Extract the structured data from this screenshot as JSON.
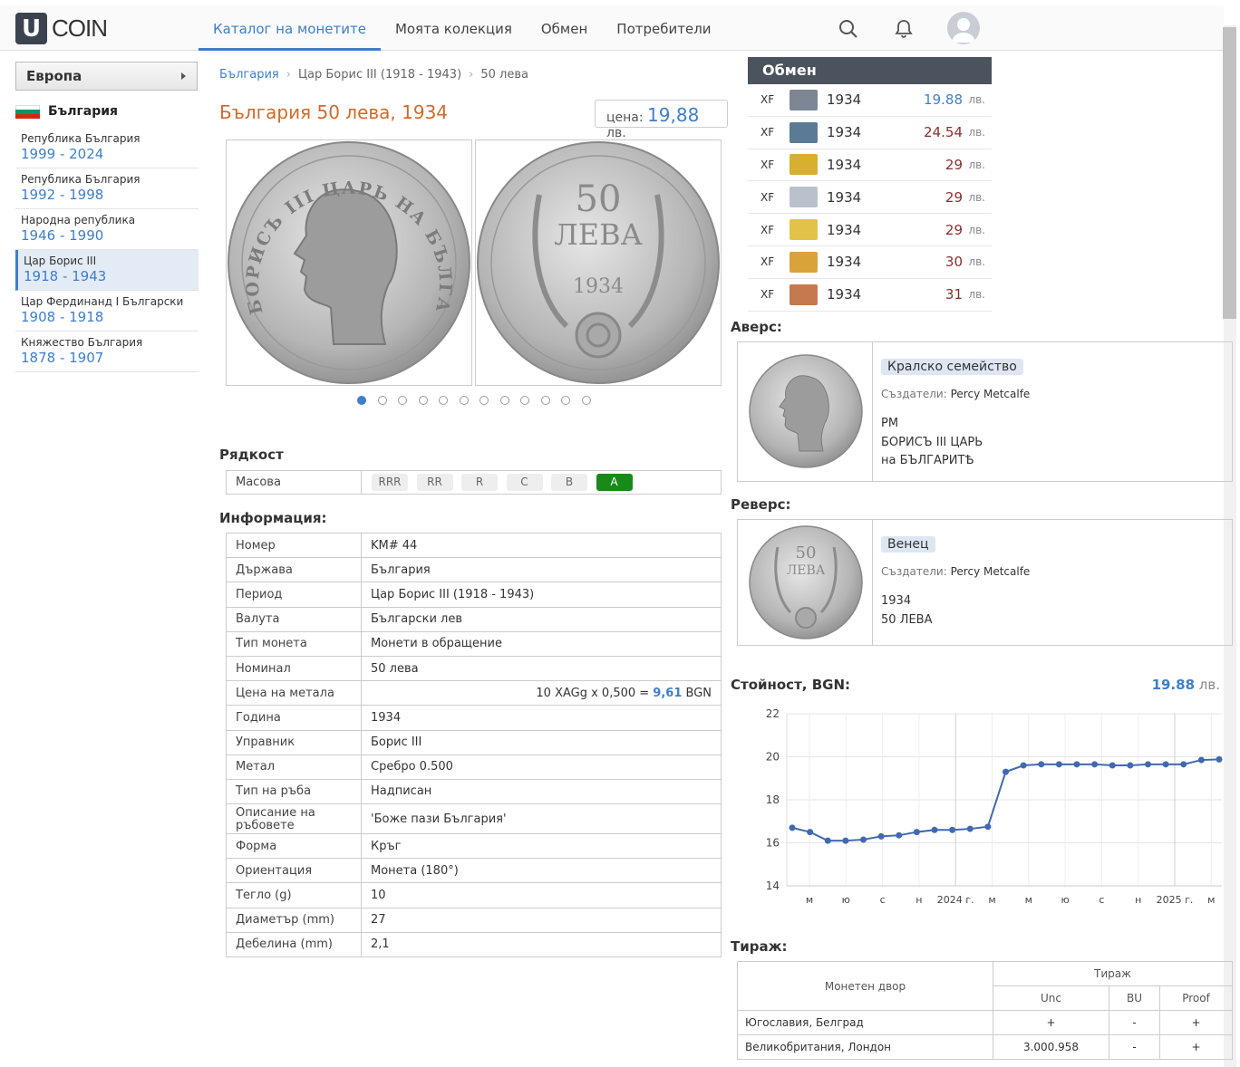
{
  "header": {
    "logo_letter": "U",
    "logo_text": "COIN",
    "nav": [
      "Каталог на монетите",
      "Моята колекция",
      "Обмен",
      "Потребители"
    ]
  },
  "sidebar": {
    "region": "Европа",
    "country": "България",
    "periods": [
      {
        "name": "Република България",
        "years": "1999 - 2024"
      },
      {
        "name": "Република България",
        "years": "1992 - 1998"
      },
      {
        "name": "Народна република",
        "years": "1946 - 1990"
      },
      {
        "name": "Цар Борис III",
        "years": "1918 - 1943"
      },
      {
        "name": "Цар Фердинанд I Български",
        "years": "1908 - 1918"
      },
      {
        "name": "Княжество България",
        "years": "1878 - 1907"
      }
    ]
  },
  "breadcrumb": [
    "България",
    "Цар Борис III (1918 - 1943)",
    "50 лева"
  ],
  "coin": {
    "title": "България 50 лева, 1934",
    "price_label": "цена:",
    "price_value": "19,88",
    "price_unit": "лв.",
    "obverse_portrait_text": "БОРИСЪ III ЦАРЬ НА БЪЛГАРИТѢ",
    "reverse_big": "50",
    "reverse_word": "ЛЕВА",
    "reverse_year": "1934"
  },
  "rarity": {
    "heading": "Рядкост",
    "label": "Масова",
    "levels": [
      "RRR",
      "RR",
      "R",
      "C",
      "B",
      "A"
    ],
    "active": "A"
  },
  "info": {
    "heading": "Информация:",
    "rows": [
      {
        "k": "Номер",
        "v": "KM# 44"
      },
      {
        "k": "Държава",
        "v": "България"
      },
      {
        "k": "Период",
        "v": "Цар Борис III (1918 - 1943)"
      },
      {
        "k": "Валута",
        "v": "Български лев"
      },
      {
        "k": "Тип монета",
        "v": "Монети в обращение"
      },
      {
        "k": "Номинал",
        "v": "50 лева"
      },
      {
        "k": "Цена на метала",
        "v": "10 XAGg x 0,500 = ",
        "v_bold": "9,61",
        "v_tail": " BGN"
      },
      {
        "k": "Година",
        "v": "1934"
      },
      {
        "k": "Управник",
        "v": "Борис III"
      },
      {
        "k": "Метал",
        "v": "Сребро 0.500"
      },
      {
        "k": "Тип на ръба",
        "v": "Надписан"
      },
      {
        "k": "Описание на ръбовете",
        "v": "'Боже пази България'"
      },
      {
        "k": "Форма",
        "v": "Кръг"
      },
      {
        "k": "Ориентация",
        "v": "Монета (180°)"
      },
      {
        "k": "Тегло (g)",
        "v": "10"
      },
      {
        "k": "Диаметър (mm)",
        "v": "27"
      },
      {
        "k": "Дебелина (mm)",
        "v": "2,1"
      }
    ]
  },
  "exchange": {
    "heading": "Обмен",
    "rows": [
      {
        "grade": "XF",
        "year": "1934",
        "price": "19.88",
        "unit": "лв.",
        "color": "#3f7ec9",
        "thumb": "#7d8694"
      },
      {
        "grade": "XF",
        "year": "1934",
        "price": "24.54",
        "unit": "лв.",
        "color": "#8b2d2d",
        "thumb": "#5b7a94"
      },
      {
        "grade": "XF",
        "year": "1934",
        "price": "29",
        "unit": "лв.",
        "color": "#8b2d2d",
        "thumb": "#d8b030"
      },
      {
        "grade": "XF",
        "year": "1934",
        "price": "29",
        "unit": "лв.",
        "color": "#8b2d2d",
        "thumb": "#b9c2cc"
      },
      {
        "grade": "XF",
        "year": "1934",
        "price": "29",
        "unit": "лв.",
        "color": "#8b2d2d",
        "thumb": "#e3c24a"
      },
      {
        "grade": "XF",
        "year": "1934",
        "price": "30",
        "unit": "лв.",
        "color": "#8b2d2d",
        "thumb": "#d9a33a"
      },
      {
        "grade": "XF",
        "year": "1934",
        "price": "31",
        "unit": "лв.",
        "color": "#8b2d2d",
        "thumb": "#c47a4e"
      }
    ]
  },
  "obverse": {
    "heading": "Аверс:",
    "tag": "Кралско семейство",
    "creators_label": "Създатели:",
    "creators": "Percy Metcalfe",
    "inscription": [
      "PM",
      "БОРИСЪ III ЦАРЬ",
      "на БЪЛГАРИТѢ"
    ]
  },
  "reverse": {
    "heading": "Реверс:",
    "tag": "Венец",
    "creators_label": "Създатели:",
    "creators": "Percy Metcalfe",
    "inscription": [
      "1934",
      "50 ЛЕВА"
    ]
  },
  "value": {
    "heading": "Стойност, BGN:",
    "current": "19.88",
    "unit": "лв."
  },
  "chart_data": {
    "type": "line",
    "title": "Стойност, BGN:",
    "xlabel": "",
    "ylabel": "",
    "ylim": [
      14,
      22
    ],
    "yticks": [
      14,
      16,
      18,
      20,
      22
    ],
    "xticks": [
      "м",
      "ю",
      "с",
      "н",
      "2024 г.",
      "м",
      "м",
      "ю",
      "с",
      "н",
      "2025 г.",
      "м"
    ],
    "grid": true,
    "series": [
      {
        "color": "#4169b0",
        "values": [
          16.7,
          16.5,
          16.1,
          16.1,
          16.15,
          16.3,
          16.35,
          16.5,
          16.6,
          16.6,
          16.65,
          16.75,
          19.3,
          19.6,
          19.65,
          19.65,
          19.65,
          19.65,
          19.6,
          19.6,
          19.65,
          19.65,
          19.65,
          19.85,
          19.88
        ]
      }
    ]
  },
  "mintage": {
    "heading": "Тираж:",
    "col_mint": "Монетен двор",
    "col_group": "Тираж",
    "cols": [
      "Unc",
      "BU",
      "Proof"
    ],
    "rows": [
      {
        "mint": "Югославия, Белград",
        "unc": "+",
        "bu": "-",
        "proof": "+"
      },
      {
        "mint": "Великобритания, Лондон",
        "unc": "3.000.958",
        "bu": "-",
        "proof": "+"
      }
    ]
  }
}
